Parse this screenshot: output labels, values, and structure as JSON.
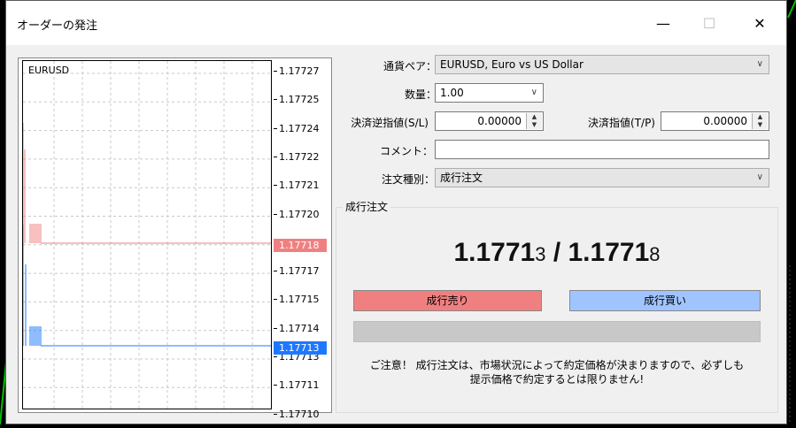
{
  "window": {
    "title": "オーダーの発注",
    "minimize": "—",
    "maximize": "☐",
    "close": "✕"
  },
  "chart": {
    "symbol": "EURUSD",
    "ticks": [
      "1.17727",
      "1.17725",
      "1.17724",
      "1.17722",
      "1.17721",
      "1.17720",
      "1.17718",
      "1.17717",
      "1.17715",
      "1.17714",
      "1.17713",
      "1.17711",
      "1.17710"
    ],
    "bid_label": "1.17718",
    "ask_label": "1.17713",
    "bid_color": "#f08080",
    "ask_color": "#1e78ff"
  },
  "form": {
    "pair_label": "通貨ペア：",
    "pair_value": "EURUSD, Euro vs US Dollar",
    "volume_label": "数量：",
    "volume_value": "1.00",
    "sl_label": "決済逆指値(S/L)",
    "sl_value": "0.00000",
    "tp_label": "決済指値(T/P)",
    "tp_value": "0.00000",
    "comment_label": "コメント：",
    "comment_value": "",
    "type_label": "注文種別：",
    "type_value": "成行注文"
  },
  "market": {
    "group_title": "成行注文",
    "bid_main": "1.1771",
    "bid_last": "3",
    "separator": " / ",
    "ask_main": "1.1771",
    "ask_last": "8",
    "sell_label": "成行売り",
    "buy_label": "成行買い",
    "sell_color": "#f08080",
    "buy_color": "#a0c4ff",
    "notice_line1": "ご注意！ 成行注文は、市場状況によって約定価格が決まりますので、必ずしも",
    "notice_line2": "提示価格で約定するとは限りません!"
  }
}
